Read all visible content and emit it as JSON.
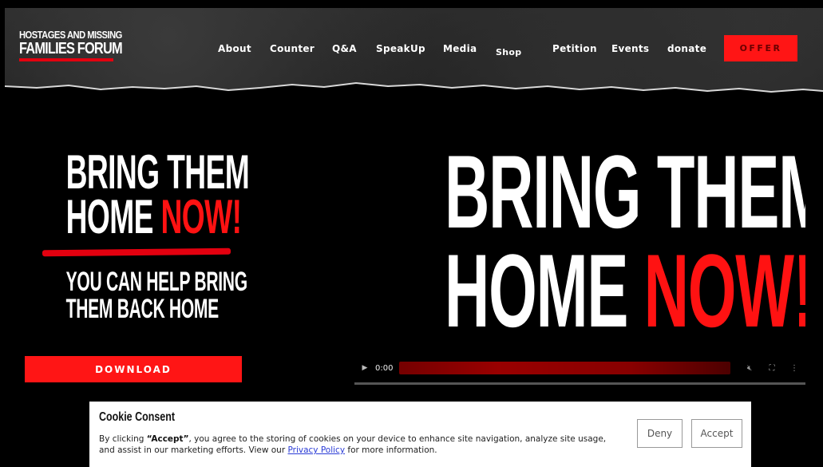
{
  "logo": {
    "line1": "HOSTAGES AND MISSING",
    "line2": "FAMILIES FORUM"
  },
  "nav": [
    {
      "label": "About",
      "icon": ""
    },
    {
      "label": "Counter"
    },
    {
      "label": "Q&A"
    },
    {
      "label": "SpeakUp"
    },
    {
      "label": "Media"
    },
    {
      "label": "Shop"
    },
    {
      "label": "Petition"
    },
    {
      "label": "Events"
    },
    {
      "label": "donate"
    }
  ],
  "offer_button": "OFFER",
  "promo": {
    "headline_line1": "BRING THEM",
    "headline_home": "HOME",
    "headline_now": "NOW!",
    "subhead_line1": "YOU CAN HELP BRING",
    "subhead_line2": "THEM BACK HOME",
    "download_label": "DOWNLOAD"
  },
  "video": {
    "title_line1": "BRING THEM",
    "title_home": "HOME",
    "title_now": "NOW!",
    "time": "0:00"
  },
  "cookie": {
    "title": "Cookie Consent",
    "text_before": "By clicking ",
    "accept_quote": "“Accept”",
    "text_middle": ", you agree to the storing of cookies on your device to enhance site navigation, analyze site usage, and assist in our marketing efforts. View our ",
    "privacy_link": "Privacy Policy",
    "text_after": " for more information.",
    "deny_label": "Deny",
    "accept_label": "Accept"
  },
  "colors": {
    "accent_red": "#ff1515",
    "background": "#000000",
    "link": "#2a3bd6"
  }
}
